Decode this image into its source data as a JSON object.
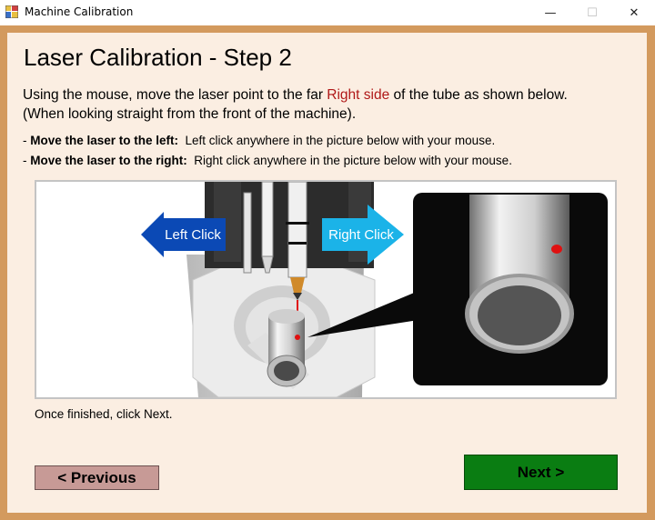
{
  "window": {
    "title": "Machine Calibration",
    "app_icon": "app-icon",
    "minimize_glyph": "—",
    "maximize_glyph": "☐",
    "close_glyph": "✕"
  },
  "content": {
    "heading": "Laser Calibration - Step 2",
    "instruction_pre": "Using the mouse, move the laser point to the far ",
    "instruction_highlight": "Right side",
    "instruction_post": " of the tube as shown below.",
    "instruction_line2": "(When looking straight from the front of the machine).",
    "left_prefix": "- ",
    "left_bold": "Move the laser to the left:",
    "left_text": "  Left click anywhere in the picture below with your mouse.",
    "right_prefix": "- ",
    "right_bold": "Move the laser to the right:",
    "right_text": "  Right click anywhere in the picture below with your mouse.",
    "finished_text": "Once finished, click Next."
  },
  "picture": {
    "left_arrow_label": "Left Click",
    "right_arrow_label": "Right Click"
  },
  "buttons": {
    "previous_label": "< Previous",
    "next_label": "Next >"
  },
  "colors": {
    "window_frame": "#d39a5e",
    "client_bg": "#fbeee2",
    "highlight_red": "#b01818",
    "left_arrow": "#0b49b5",
    "right_arrow": "#1bb3e8",
    "previous_button": "#c79a96",
    "next_button": "#0a7d12",
    "laser": "#e01010"
  }
}
